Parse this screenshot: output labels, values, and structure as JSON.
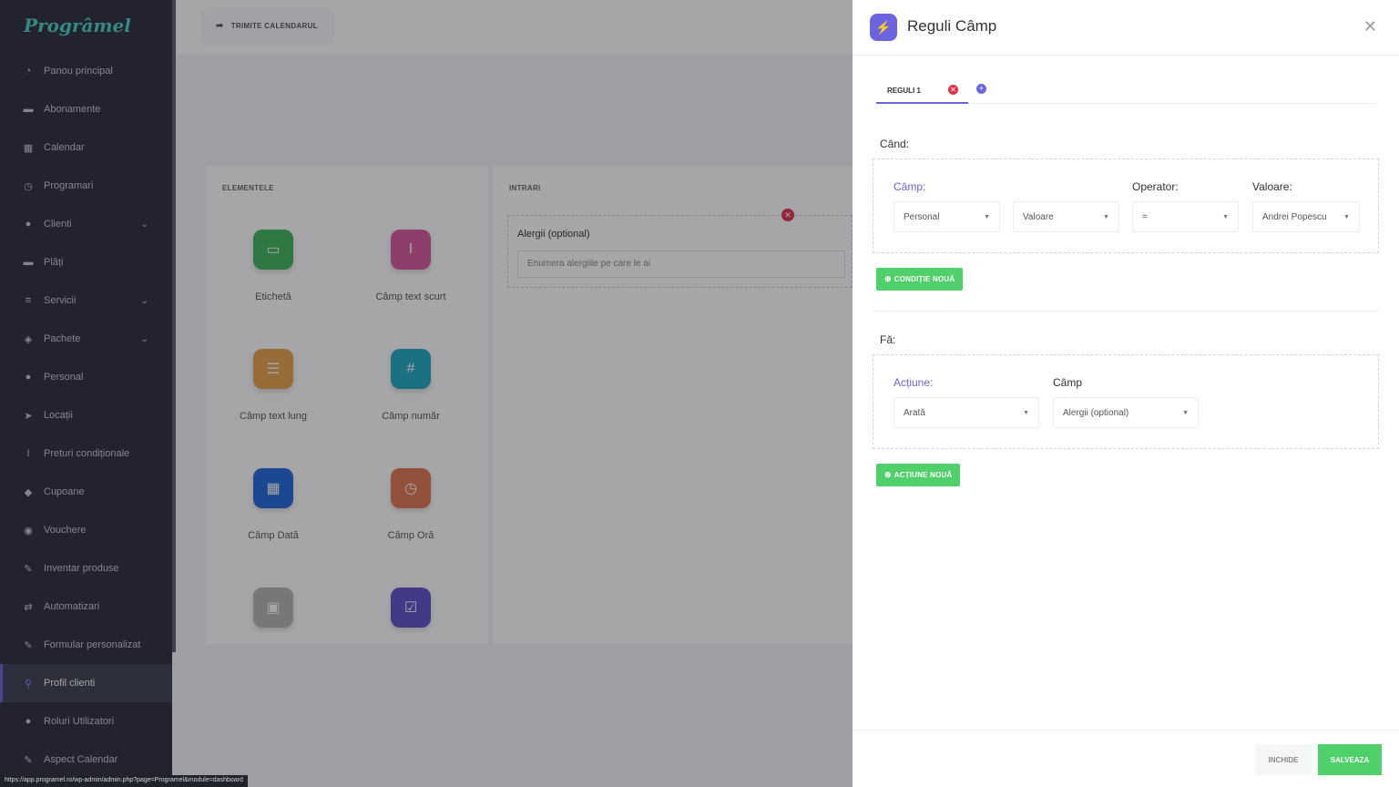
{
  "sidebar": {
    "logo": "Progrâmel",
    "items": [
      {
        "label": "Panou principal",
        "icon": "dashboard-icon"
      },
      {
        "label": "Abonamente",
        "icon": "card-icon"
      },
      {
        "label": "Calendar",
        "icon": "calendar-icon"
      },
      {
        "label": "Programari",
        "icon": "clock-icon"
      },
      {
        "label": "Clienti",
        "icon": "users-icon",
        "expandable": true
      },
      {
        "label": "Plăți",
        "icon": "card-icon"
      },
      {
        "label": "Servicii",
        "icon": "list-icon",
        "expandable": true
      },
      {
        "label": "Pachete",
        "icon": "box-icon",
        "expandable": true
      },
      {
        "label": "Personal",
        "icon": "user-icon"
      },
      {
        "label": "Locații",
        "icon": "location-icon"
      },
      {
        "label": "Preturi condiționale",
        "icon": "price-icon"
      },
      {
        "label": "Cupoane",
        "icon": "tag-icon"
      },
      {
        "label": "Vouchere",
        "icon": "voucher-icon"
      },
      {
        "label": "Inventar produse",
        "icon": "tools-icon"
      },
      {
        "label": "Automatizari",
        "icon": "automation-icon"
      },
      {
        "label": "Formular personalizat",
        "icon": "form-icon"
      },
      {
        "label": "Profil clienti",
        "icon": "profile-icon",
        "active": true
      },
      {
        "label": "Roluri Utilizatori",
        "icon": "user-plus-icon"
      },
      {
        "label": "Aspect Calendar",
        "icon": "brush-icon"
      }
    ]
  },
  "topbar": {
    "send_calendar": "TRIMITE CALENDARUL"
  },
  "elements_panel": {
    "title": "ELEMENTELE",
    "tiles": [
      {
        "label": "Etichetă",
        "color": "#3fb55c"
      },
      {
        "label": "Câmp text scurt",
        "color": "#d9589a"
      },
      {
        "label": "Câmp text lung",
        "color": "#e8a24a"
      },
      {
        "label": "Câmp număr",
        "color": "#1fa9c0"
      },
      {
        "label": "Câmp Dată",
        "color": "#2166d8"
      },
      {
        "label": "Câmp Oră",
        "color": "#e07550"
      },
      {
        "label": "",
        "color": "#b5b2ad"
      },
      {
        "label": "",
        "color": "#5b52c9"
      }
    ]
  },
  "inputs_panel": {
    "title": "INTRARI",
    "field_label": "Alergii (optional)",
    "field_placeholder": "Enumera alergiile pe care le ai"
  },
  "status_url": "https://app.programel.ro/wp-admin/admin.php?page=Programel&module=dashboard",
  "modal": {
    "title": "Reguli Câmp",
    "tab_label": "REGULI 1",
    "when_label": "Când:",
    "condition": {
      "field_label": "Câmp:",
      "field_value": "Personal",
      "sub_value": "Valoare",
      "operator_label": "Operator:",
      "operator_value": "=",
      "value_label": "Valoare:",
      "value_value": "Andrei Popescu"
    },
    "new_condition": "CONDIȚIE NOUĂ",
    "do_label": "Fă:",
    "action": {
      "action_label": "Acțiune:",
      "action_value": "Arată",
      "field_label": "Câmp",
      "field_value": "Alergii (optional)"
    },
    "new_action": "ACȚIUNE NOUĂ",
    "close_btn": "INCHIDE",
    "save_btn": "SALVEAZA"
  },
  "colors": {
    "accent": "#6c63e0",
    "green": "#4fd06a",
    "danger": "#e0334c"
  }
}
